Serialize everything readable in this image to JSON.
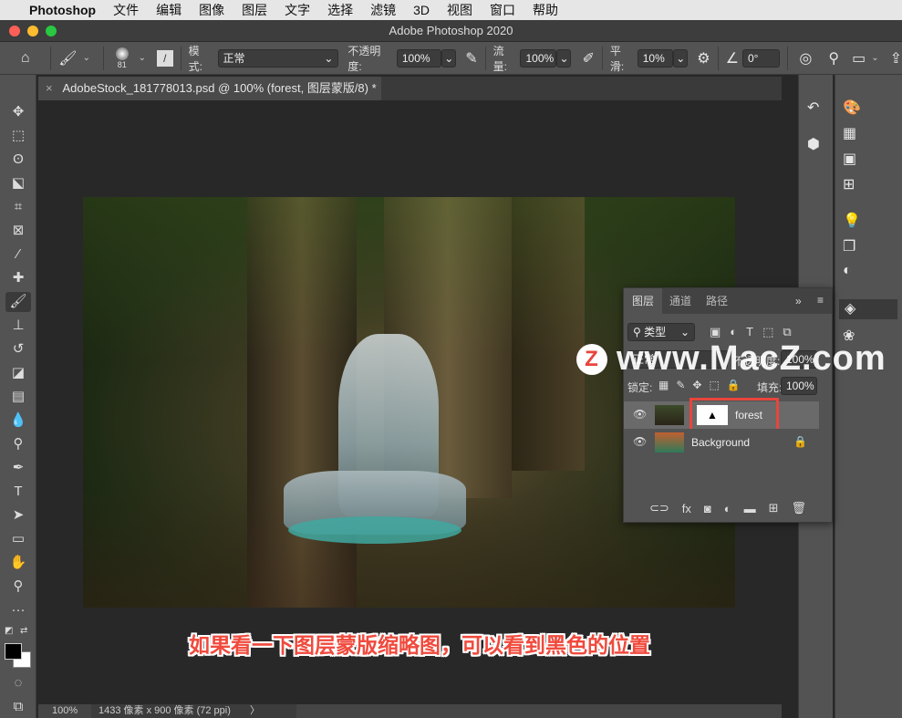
{
  "menubar": {
    "app": "Photoshop",
    "items": [
      "文件",
      "编辑",
      "图像",
      "图层",
      "文字",
      "选择",
      "滤镜",
      "3D",
      "视图",
      "窗口",
      "帮助"
    ]
  },
  "window": {
    "title": "Adobe Photoshop 2020"
  },
  "options": {
    "brush_size": "81",
    "mode_label": "模式:",
    "mode_value": "正常",
    "opacity_label": "不透明度:",
    "opacity_value": "100%",
    "flow_label": "流量:",
    "flow_value": "100%",
    "smoothing_label": "平滑:",
    "smoothing_value": "10%",
    "angle_value": "0°"
  },
  "document": {
    "tab_title": "AdobeStock_181778013.psd @ 100% (forest, 图层蒙版/8) *",
    "close": "×"
  },
  "status": {
    "zoom": "100%",
    "info": "1433 像素 x 900 像素 (72 ppi)",
    "arrow": "〉"
  },
  "layers_panel": {
    "tabs": [
      "图层",
      "通道",
      "路径"
    ],
    "filter_label": "类型",
    "blend_mode": "正常",
    "opacity_label": "不透明度:",
    "opacity_value": "100%",
    "lock_label": "锁定:",
    "fill_label": "填充:",
    "fill_value": "100%",
    "layers": [
      {
        "name": "forest",
        "visible": true,
        "has_mask": true,
        "selected": true
      },
      {
        "name": "Background",
        "visible": true,
        "locked": true
      }
    ]
  },
  "caption": "如果看一下图层蒙版缩略图，可以看到黑色的位置",
  "watermark": "www.MacZ.com",
  "colors": {
    "accent_red": "#f04a3d",
    "highlight_box": "#e8453c"
  }
}
